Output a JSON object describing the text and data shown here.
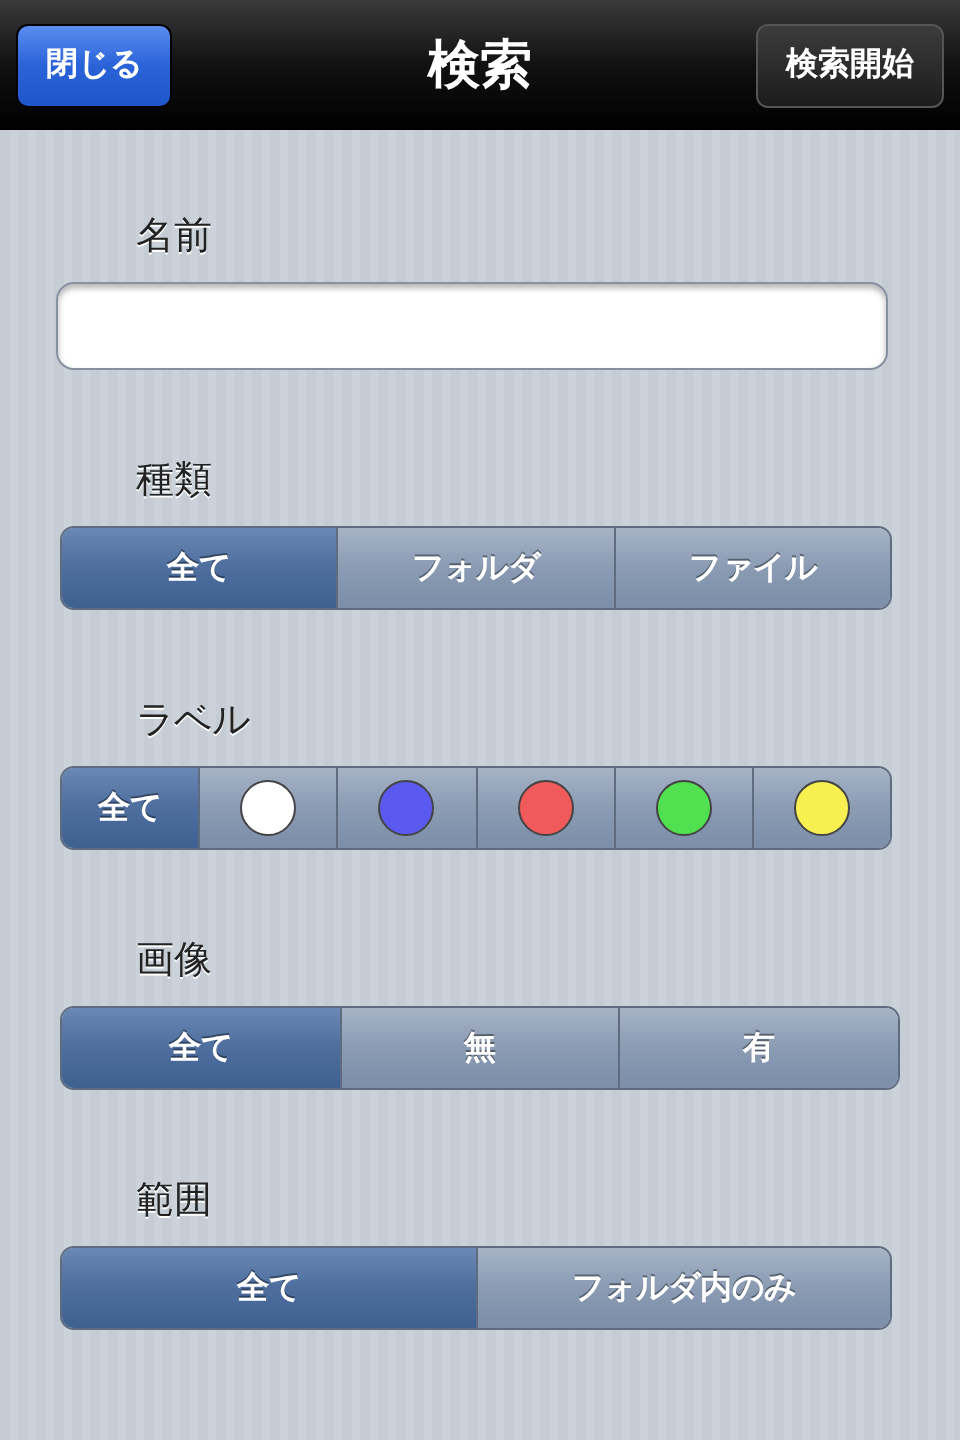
{
  "nav_bar": {
    "close_button": "閉じる",
    "title": "検索",
    "start_button": "検索開始"
  },
  "sections": [
    {
      "label": "名前",
      "kind": "field"
    },
    {
      "label": "種類",
      "kind": "segments",
      "segments": [
        {
          "kind": "text",
          "label": "全て",
          "selected": true
        },
        {
          "kind": "text",
          "label": "フォルダ",
          "selected": false
        },
        {
          "kind": "text",
          "label": "ファイル",
          "selected": false
        }
      ]
    },
    {
      "label": "ラベル",
      "kind": "segments",
      "segments": [
        {
          "kind": "text",
          "label": "全て",
          "selected": true
        },
        {
          "kind": "dot",
          "color": "#ffffff",
          "selected": false
        },
        {
          "kind": "dot",
          "color": "#5a5af0",
          "selected": false
        },
        {
          "kind": "dot",
          "color": "#f05a5a",
          "selected": false
        },
        {
          "kind": "dot",
          "color": "#50e050",
          "selected": false
        },
        {
          "kind": "dot",
          "color": "#f8f050",
          "selected": false
        }
      ]
    },
    {
      "label": "画像",
      "kind": "segments",
      "segments": [
        {
          "kind": "text",
          "label": "全て",
          "selected": true
        },
        {
          "kind": "text",
          "label": "無",
          "selected": false
        },
        {
          "kind": "text",
          "label": "有",
          "selected": false
        }
      ]
    },
    {
      "label": "範囲",
      "kind": "segments",
      "segments": [
        {
          "kind": "text",
          "label": "全て",
          "selected": true
        },
        {
          "kind": "text",
          "label": "フォルダ内のみ",
          "selected": false
        }
      ]
    }
  ]
}
